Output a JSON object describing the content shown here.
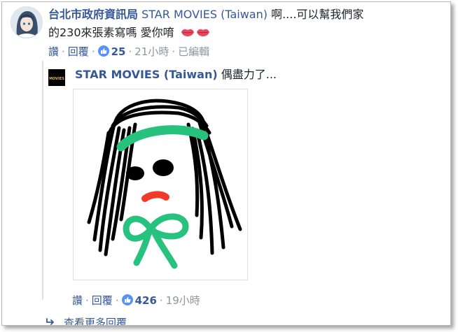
{
  "comment": {
    "author": "台北市政府資訊局",
    "mention": "STAR MOVIES (Taiwan)",
    "text_line1": "啊....可以幫我們家",
    "text_line2": "的230來張素寫嗎 愛你唷",
    "actions": {
      "like": "讚",
      "reply": "回覆",
      "like_count": "25",
      "time": "21小時",
      "edited": "已編輯"
    }
  },
  "reply": {
    "logo_text": "MOVIES",
    "author": "STAR MOVIES (Taiwan)",
    "text": "偶盡力了...",
    "actions": {
      "like": "讚",
      "reply": "回覆",
      "like_count": "426",
      "time": "19小時"
    }
  },
  "view_more": "查看更多回覆",
  "colors": {
    "link": "#365899",
    "meta": "#90949c",
    "like_badge": "#5890ff",
    "lips": "#e8475f"
  },
  "icons": {
    "lips": "lips-icon",
    "like": "thumbs-up-icon",
    "reply_arrow": "reply-arrow-icon"
  }
}
